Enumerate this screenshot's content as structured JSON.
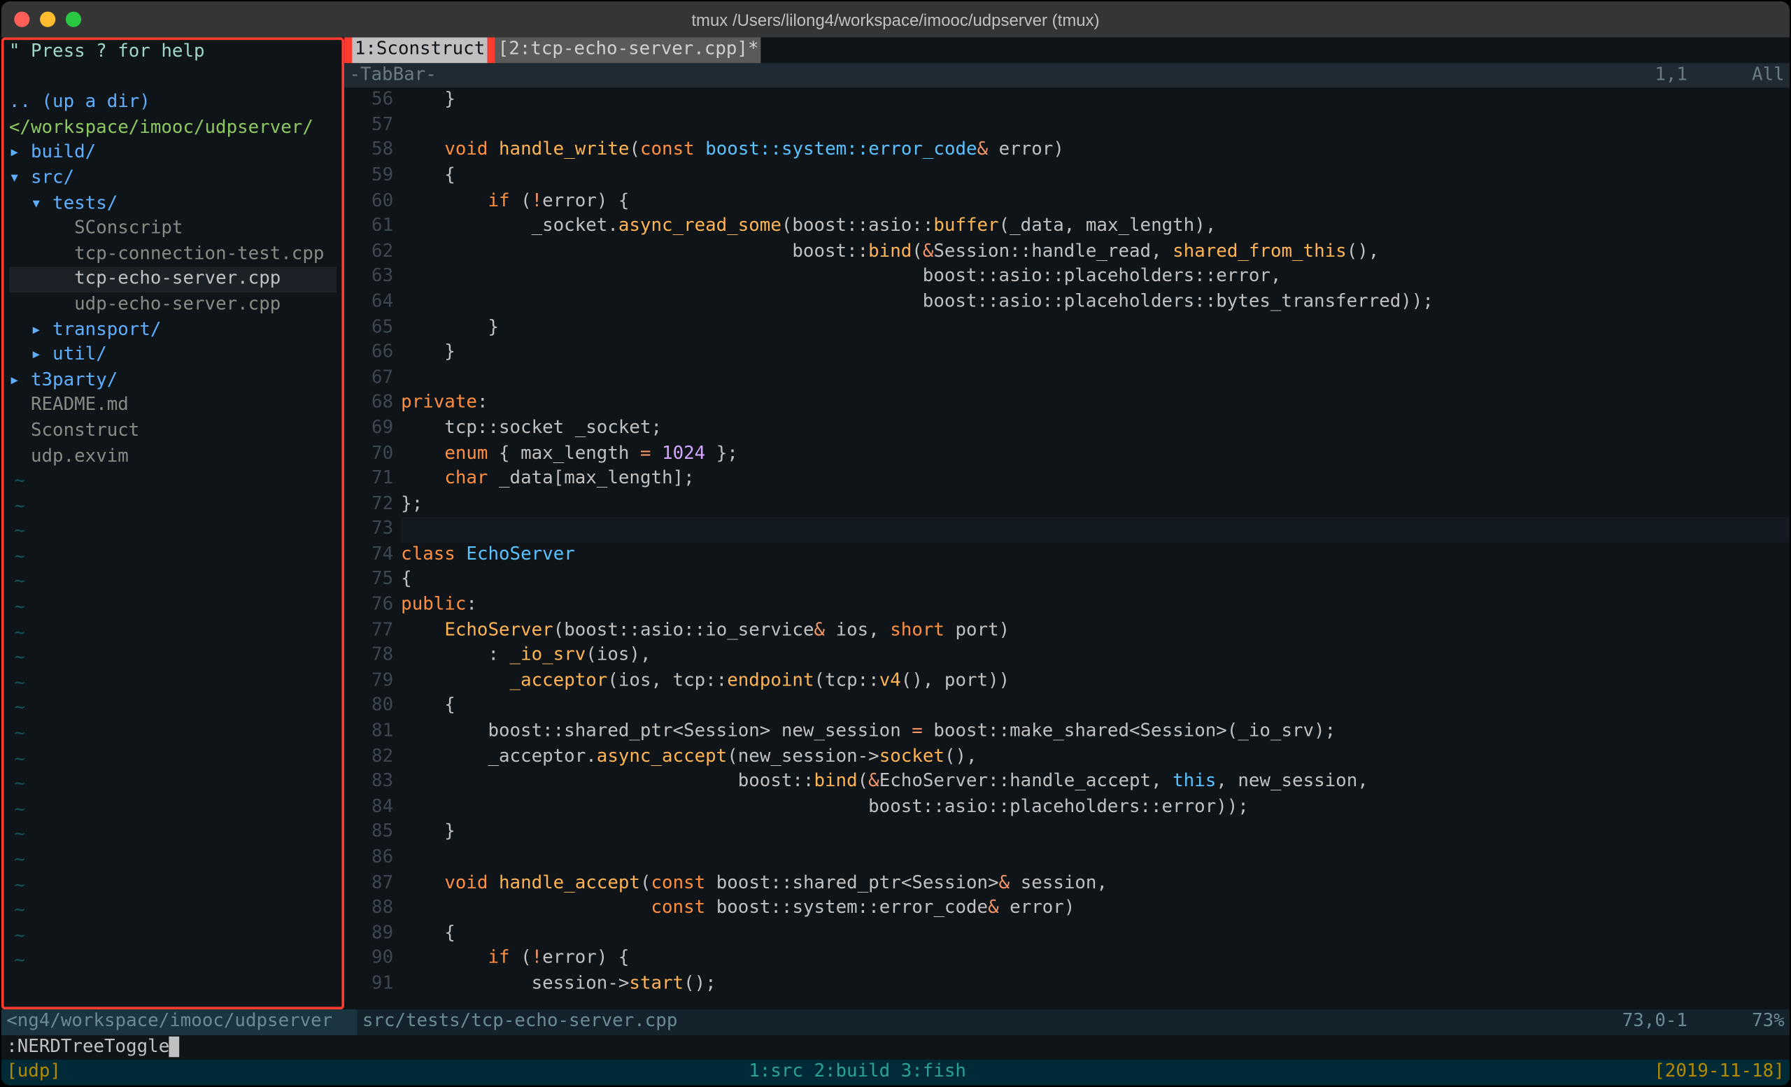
{
  "window": {
    "title": "tmux /Users/lilong4/workspace/imooc/udpserver (tmux)"
  },
  "sidebar": {
    "help": "\" Press ? for help",
    "up": ".. (up a dir)",
    "path": "</workspace/imooc/udpserver/",
    "items": [
      {
        "indent": 0,
        "tri": "▸",
        "label": "build/",
        "dir": true
      },
      {
        "indent": 0,
        "tri": "▾",
        "label": "src/",
        "dir": true
      },
      {
        "indent": 1,
        "tri": "▾",
        "label": "tests/",
        "dir": true
      },
      {
        "indent": 2,
        "tri": " ",
        "label": "SConscript",
        "dir": false
      },
      {
        "indent": 2,
        "tri": " ",
        "label": "tcp-connection-test.cpp",
        "dir": false
      },
      {
        "indent": 2,
        "tri": " ",
        "label": "tcp-echo-server.cpp",
        "dir": false,
        "selected": true
      },
      {
        "indent": 2,
        "tri": " ",
        "label": "udp-echo-server.cpp",
        "dir": false
      },
      {
        "indent": 1,
        "tri": "▸",
        "label": "transport/",
        "dir": true
      },
      {
        "indent": 1,
        "tri": "▸",
        "label": "util/",
        "dir": true
      },
      {
        "indent": 0,
        "tri": "▸",
        "label": "t3party/",
        "dir": true
      },
      {
        "indent": 0,
        "tri": " ",
        "label": "README.md",
        "dir": false
      },
      {
        "indent": 0,
        "tri": " ",
        "label": "Sconstruct",
        "dir": false
      },
      {
        "indent": 0,
        "tri": " ",
        "label": "udp.exvim",
        "dir": false
      }
    ]
  },
  "tabs": {
    "t1": "1:Sconstruct ",
    "t2": "[2:tcp-echo-server.cpp]*"
  },
  "tabbar": {
    "label": "-TabBar-",
    "pos": "1,1",
    "pct": "All"
  },
  "code_start": 56,
  "code": [
    [
      [
        "    ",
        "p"
      ],
      [
        "}",
        "p"
      ]
    ],
    [],
    [
      [
        "    ",
        "p"
      ],
      [
        "void",
        "kw"
      ],
      [
        " ",
        "p"
      ],
      [
        "handle_write",
        "func"
      ],
      [
        "(",
        "p"
      ],
      [
        "const",
        "kw"
      ],
      [
        " boost::system::error_code",
        "type"
      ],
      [
        "&",
        "op"
      ],
      [
        " error)",
        "p"
      ]
    ],
    [
      [
        "    {",
        "p"
      ]
    ],
    [
      [
        "        ",
        "p"
      ],
      [
        "if",
        "kw"
      ],
      [
        " (",
        "p"
      ],
      [
        "!",
        "op"
      ],
      [
        "error) {",
        "p"
      ]
    ],
    [
      [
        "            _socket.",
        "p"
      ],
      [
        "async_read_some",
        "func"
      ],
      [
        "(boost::asio::",
        "p"
      ],
      [
        "buffer",
        "func"
      ],
      [
        "(_data, max_length),",
        "p"
      ]
    ],
    [
      [
        "                                    boost::",
        "p"
      ],
      [
        "bind",
        "func"
      ],
      [
        "(",
        "p"
      ],
      [
        "&",
        "op"
      ],
      [
        "Session::handle_read, ",
        "p"
      ],
      [
        "shared_from_this",
        "func"
      ],
      [
        "(),",
        "p"
      ]
    ],
    [
      [
        "                                                boost::asio::placeholders::error,",
        "p"
      ]
    ],
    [
      [
        "                                                boost::asio::placeholders::bytes_transferred));",
        "p"
      ]
    ],
    [
      [
        "        }",
        "p"
      ]
    ],
    [
      [
        "    }",
        "p"
      ]
    ],
    [],
    [
      [
        "private",
        "kw"
      ],
      [
        ":",
        "p"
      ]
    ],
    [
      [
        "    tcp::socket _socket;",
        "p"
      ]
    ],
    [
      [
        "    ",
        "p"
      ],
      [
        "enum",
        "kw"
      ],
      [
        " { max_length ",
        "p"
      ],
      [
        "=",
        "op"
      ],
      [
        " ",
        "p"
      ],
      [
        "1024",
        "num"
      ],
      [
        " };",
        "p"
      ]
    ],
    [
      [
        "    ",
        "p"
      ],
      [
        "char",
        "kw"
      ],
      [
        " _data[max_length];",
        "p"
      ]
    ],
    [
      [
        "};",
        "p"
      ]
    ],
    [],
    [
      [
        "class",
        "kw"
      ],
      [
        " ",
        "p"
      ],
      [
        "EchoServer",
        "type"
      ]
    ],
    [
      [
        "{",
        "p"
      ]
    ],
    [
      [
        "public",
        "kw"
      ],
      [
        ":",
        "p"
      ]
    ],
    [
      [
        "    ",
        "p"
      ],
      [
        "EchoServer",
        "func"
      ],
      [
        "(boost::asio::io_service",
        "p"
      ],
      [
        "&",
        "op"
      ],
      [
        " ios, ",
        "p"
      ],
      [
        "short",
        "kw"
      ],
      [
        " port)",
        "p"
      ]
    ],
    [
      [
        "        : ",
        "p"
      ],
      [
        "_io_srv",
        "func"
      ],
      [
        "(ios),",
        "p"
      ]
    ],
    [
      [
        "          ",
        "p"
      ],
      [
        "_acceptor",
        "func"
      ],
      [
        "(ios, tcp::",
        "p"
      ],
      [
        "endpoint",
        "func"
      ],
      [
        "(tcp::",
        "p"
      ],
      [
        "v4",
        "func"
      ],
      [
        "(), port))",
        "p"
      ]
    ],
    [
      [
        "    {",
        "p"
      ]
    ],
    [
      [
        "        boost::shared_ptr<Session> new_session ",
        "p"
      ],
      [
        "=",
        "op"
      ],
      [
        " boost::make_shared<Session>(_io_srv);",
        "p"
      ]
    ],
    [
      [
        "        _acceptor.",
        "p"
      ],
      [
        "async_accept",
        "func"
      ],
      [
        "(new_session->",
        "p"
      ],
      [
        "socket",
        "func"
      ],
      [
        "(),",
        "p"
      ]
    ],
    [
      [
        "                               boost::",
        "p"
      ],
      [
        "bind",
        "func"
      ],
      [
        "(",
        "p"
      ],
      [
        "&",
        "op"
      ],
      [
        "EchoServer::handle_accept, ",
        "p"
      ],
      [
        "this",
        "this"
      ],
      [
        ", new_session,",
        "p"
      ]
    ],
    [
      [
        "                                           boost::asio::placeholders::error));",
        "p"
      ]
    ],
    [
      [
        "    }",
        "p"
      ]
    ],
    [],
    [
      [
        "    ",
        "p"
      ],
      [
        "void",
        "kw"
      ],
      [
        " ",
        "p"
      ],
      [
        "handle_accept",
        "func"
      ],
      [
        "(",
        "p"
      ],
      [
        "const",
        "kw"
      ],
      [
        " boost::shared_ptr<Session>",
        "p"
      ],
      [
        "&",
        "op"
      ],
      [
        " session,",
        "p"
      ]
    ],
    [
      [
        "                       ",
        "p"
      ],
      [
        "const",
        "kw"
      ],
      [
        " boost::system::error_code",
        "p"
      ],
      [
        "&",
        "op"
      ],
      [
        " error)",
        "p"
      ]
    ],
    [
      [
        "    {",
        "p"
      ]
    ],
    [
      [
        "        ",
        "p"
      ],
      [
        "if",
        "kw"
      ],
      [
        " (",
        "p"
      ],
      [
        "!",
        "op"
      ],
      [
        "error) {",
        "p"
      ]
    ],
    [
      [
        "            session->",
        "p"
      ],
      [
        "start",
        "func"
      ],
      [
        "();",
        "p"
      ]
    ]
  ],
  "cursor_line": 73,
  "status": {
    "left": "<ng4/workspace/imooc/udpserver",
    "file": "src/tests/tcp-echo-server.cpp",
    "pos": "73,0-1",
    "pct": "73%"
  },
  "cmdline": ":NERDTreeToggle",
  "tmux": {
    "left": "[udp]",
    "center": "1:src 2:build 3:fish",
    "right": "[2019-11-18]"
  }
}
